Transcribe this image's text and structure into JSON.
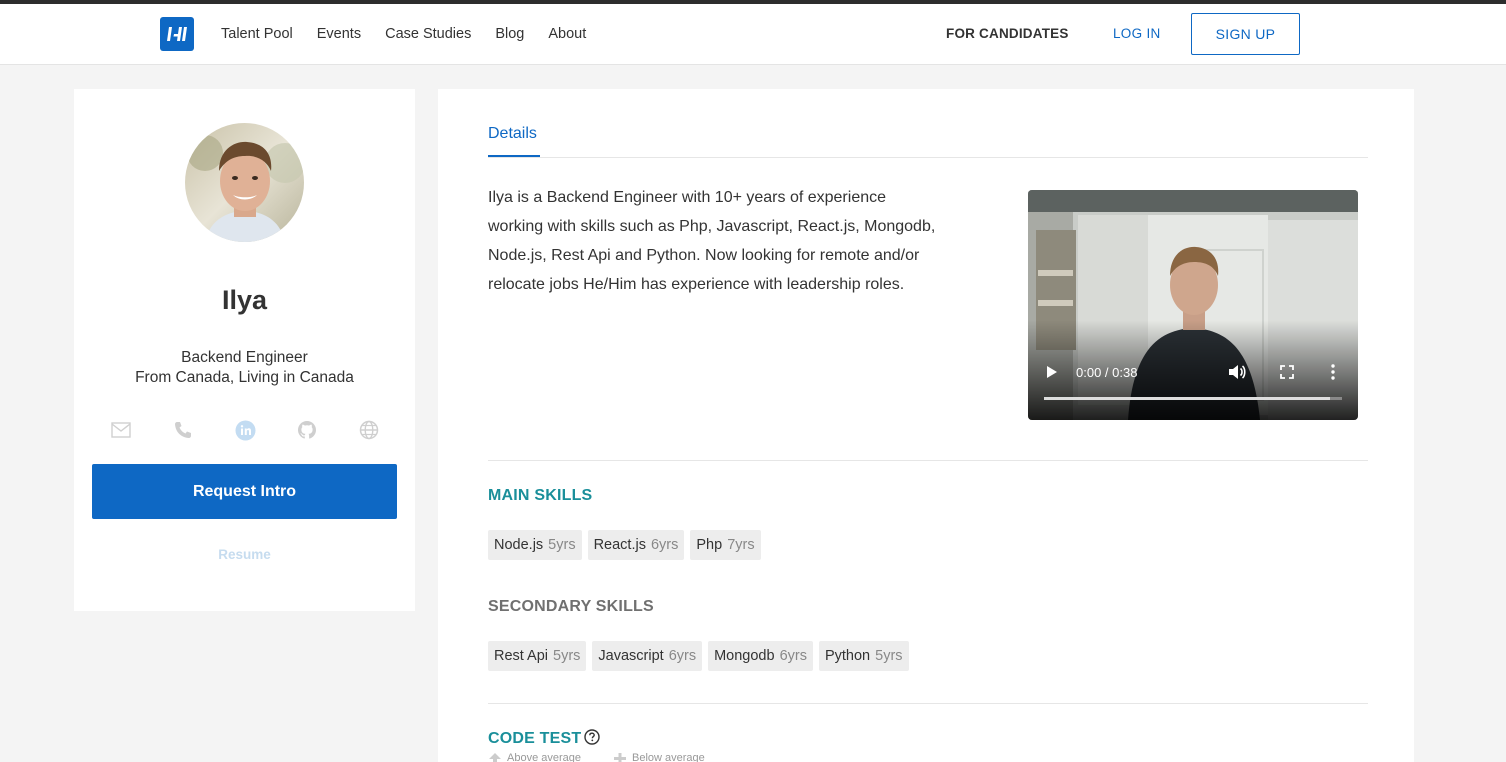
{
  "nav": {
    "links": [
      "Talent Pool",
      "Events",
      "Case Studies",
      "Blog",
      "About"
    ],
    "for_candidates": "FOR CANDIDATES",
    "log_in": "LOG IN",
    "sign_up": "SIGN UP"
  },
  "profile": {
    "name": "Ilya",
    "role": "Backend Engineer",
    "location": "From Canada, Living in Canada",
    "request_intro": "Request Intro",
    "resume": "Resume",
    "contact_icons": [
      "mail-icon",
      "phone-icon",
      "linkedin-icon",
      "github-icon",
      "globe-icon"
    ]
  },
  "details": {
    "tab": "Details",
    "bio": "Ilya is a Backend Engineer with 10+ years of experience working with skills such as Php, Javascript, React.js, Mongodb, Node.js, Rest Api and Python. Now looking for remote and/or relocate jobs He/Him has experience with leadership roles.",
    "video": {
      "time": "0:00 / 0:38",
      "progress": 0.96
    }
  },
  "main_skills": {
    "title": "MAIN SKILLS",
    "items": [
      {
        "name": "Node.js",
        "years": "5yrs"
      },
      {
        "name": "React.js",
        "years": "6yrs"
      },
      {
        "name": "Php",
        "years": "7yrs"
      }
    ]
  },
  "secondary_skills": {
    "title": "SECONDARY SKILLS",
    "items": [
      {
        "name": "Rest Api",
        "years": "5yrs"
      },
      {
        "name": "Javascript",
        "years": "6yrs"
      },
      {
        "name": "Mongodb",
        "years": "6yrs"
      },
      {
        "name": "Python",
        "years": "5yrs"
      }
    ]
  },
  "code_test": {
    "title": "CODE TEST",
    "legend": [
      "Above average",
      "Below average"
    ]
  },
  "colors": {
    "brand": "#0e68c4",
    "section_accent": "#1a8f9a",
    "page_bg": "#f4f4f4"
  }
}
